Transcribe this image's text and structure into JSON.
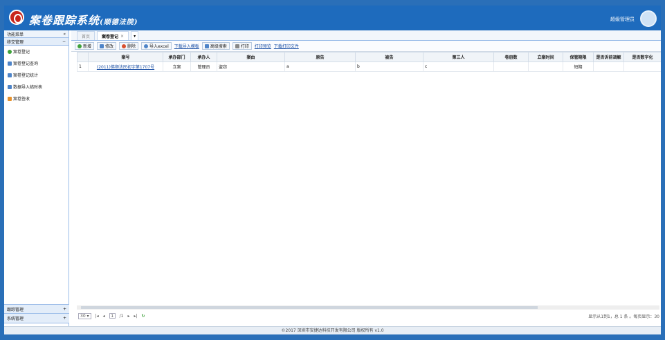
{
  "header": {
    "title": "案卷跟踪系统",
    "subtitle": "(顺德法院)",
    "user": "超级管理员"
  },
  "sidebar": {
    "title": "功能菜单",
    "collapse": "«",
    "group": "移交管理",
    "group_toggle": "−",
    "items": [
      {
        "label": "案卷登记",
        "icon": "plus-circle-icon"
      },
      {
        "label": "案卷登记查询",
        "icon": "document-icon"
      },
      {
        "label": "案卷登记统计",
        "icon": "document-icon"
      },
      {
        "label": "数据导入临时表",
        "icon": "document-icon"
      },
      {
        "label": "案卷签收",
        "icon": "folder-icon"
      }
    ],
    "bottom_groups": [
      {
        "label": "跟踪管理",
        "toggle": "+"
      },
      {
        "label": "系统管理",
        "toggle": "+"
      }
    ]
  },
  "tabs": {
    "home": "首页",
    "active": "案卷登记",
    "close": "×",
    "more": "▾"
  },
  "toolbar": {
    "add": "新增",
    "edit": "修改",
    "delete": "删除",
    "import": "导入excel",
    "download_template": "下载导入模板",
    "advanced_search": "高级搜索",
    "print": "打印",
    "print_preview": "打印预览",
    "download_print": "下载打印文件"
  },
  "table": {
    "columns": [
      "案号",
      "承办部门",
      "承办人",
      "案由",
      "原告",
      "被告",
      "第三人",
      "卷册数",
      "立案时间",
      "保管期限",
      "是否诉前调解",
      "是否数字化"
    ],
    "rows": [
      {
        "index": "1",
        "case_no": "(2011)佛顺法民初字第1707号",
        "dept": "立案",
        "handler": "管理员",
        "cause": "盗窃",
        "plaintiff": "a",
        "defendant": "b",
        "third": "c",
        "volumes": "",
        "filed": "",
        "retention": "短期",
        "mediation": "",
        "digital": ""
      }
    ]
  },
  "pager": {
    "page_size": "30",
    "page_input": "1",
    "total_pages": "/1",
    "status": "显示从1到1，总 1 条 。每页显示：30"
  },
  "footer": "©2017 深圳市安捷达科技开发有限公司 版权所有 v1.0"
}
